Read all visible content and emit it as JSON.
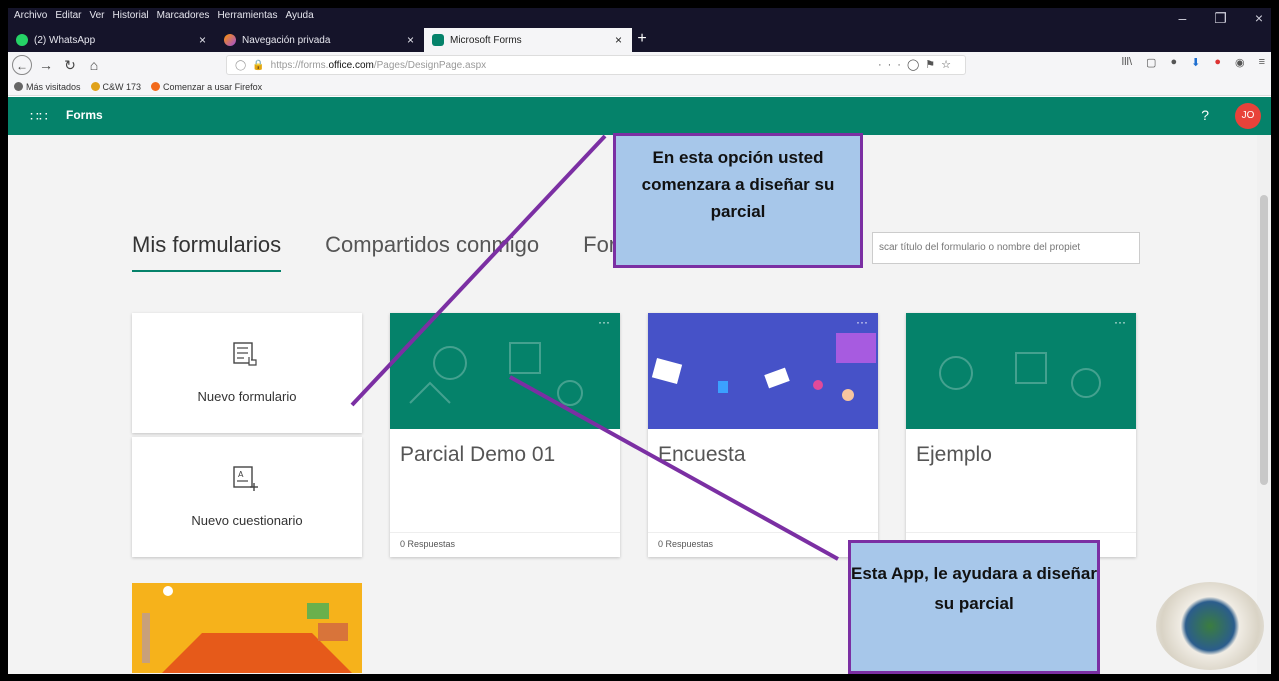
{
  "browser": {
    "menu": [
      "Archivo",
      "Editar",
      "Ver",
      "Historial",
      "Marcadores",
      "Herramientas",
      "Ayuda"
    ],
    "tabs": [
      {
        "label": "(2) WhatsApp",
        "favicon_color": "#25d366"
      },
      {
        "label": "Navegación privada",
        "favicon_color": "#9d4ddb"
      },
      {
        "label": "Microsoft Forms",
        "favicon_color": "#05826a"
      }
    ],
    "url": {
      "prefix": "https://forms.",
      "domain": "office.com",
      "path": "/Pages/DesignPage.aspx"
    },
    "bookmarks": [
      {
        "label": "Más visitados",
        "icon": "gear-icon"
      },
      {
        "label": "C&W 173",
        "icon": "flower-icon"
      },
      {
        "label": "Comenzar a usar Firefox",
        "icon": "firefox-icon"
      }
    ]
  },
  "forms": {
    "app_title": "Forms",
    "help": "?",
    "avatar_initials": "JO",
    "accent": "#05826a",
    "nav_tabs": [
      "Mis formularios",
      "Compartidos conmigo",
      "Form"
    ],
    "search_placeholder": "scar título del formulario o nombre del propiet",
    "new_form_label": "Nuevo formulario",
    "new_quiz_label": "Nuevo cuestionario",
    "cards": [
      {
        "title": "Parcial Demo 01",
        "responses": "0 Respuestas"
      },
      {
        "title": "Encuesta",
        "responses": "0 Respuestas"
      },
      {
        "title": "Ejemplo",
        "responses": ""
      }
    ],
    "card_menu": "···"
  },
  "annotations": {
    "callout_top": "En esta opción usted comenzara a diseñar su parcial",
    "callout_bottom": "Esta App, le ayudara a diseñar su parcial",
    "callout_fill": "#a7c7ea",
    "callout_border": "#7b2fa3"
  }
}
